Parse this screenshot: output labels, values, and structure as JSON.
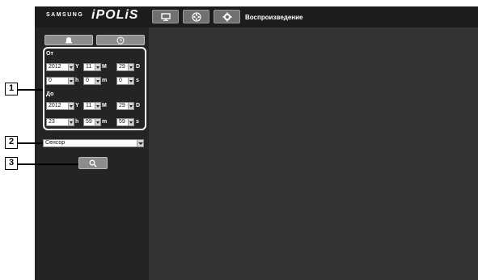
{
  "header": {
    "brand_small": "SAMSUNG",
    "brand_big": "iPOLiS",
    "title": "Воспроизведение",
    "buttons": [
      {
        "icon": "monitor-icon"
      },
      {
        "icon": "film-reel-icon"
      },
      {
        "icon": "gear-icon"
      }
    ]
  },
  "sidebar": {
    "tabs": [
      {
        "icon": "alarm-bell-icon"
      },
      {
        "icon": "clock-icon"
      }
    ],
    "from": {
      "label": "От",
      "year": "2012",
      "year_unit": "Y",
      "month": "11",
      "month_unit": "M",
      "day": "29",
      "day_unit": "D",
      "hour": "0",
      "hour_unit": "h",
      "minute": "0",
      "minute_unit": "m",
      "second": "0",
      "second_unit": "s"
    },
    "to": {
      "label": "До",
      "year": "2012",
      "year_unit": "Y",
      "month": "11",
      "month_unit": "M",
      "day": "29",
      "day_unit": "D",
      "hour": "23",
      "hour_unit": "h",
      "minute": "59",
      "minute_unit": "m",
      "second": "59",
      "second_unit": "s"
    },
    "sensor_value": "Сенсор",
    "search_icon": "search-icon"
  },
  "callouts": [
    "1",
    "2",
    "3"
  ],
  "colors": {
    "frame": "#2b2b2b",
    "topbar": "#1c1c1c",
    "content": "#333333",
    "button": "#8c8c8c"
  }
}
